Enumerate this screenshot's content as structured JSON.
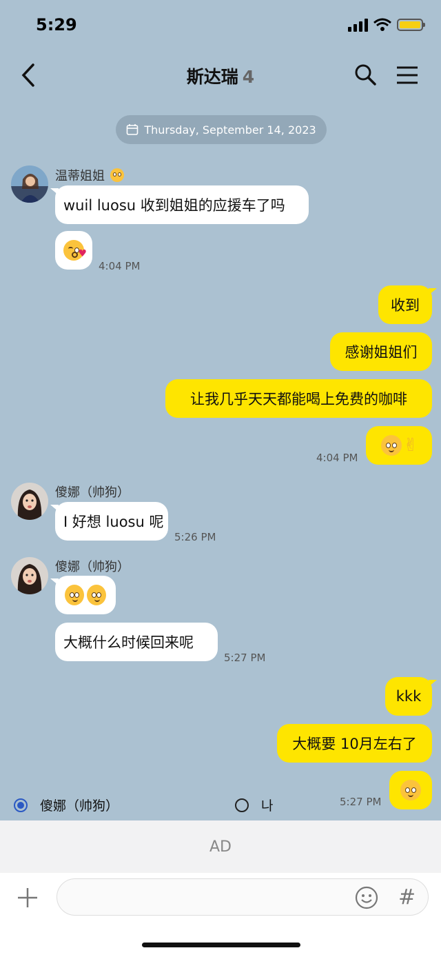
{
  "status_bar": {
    "time": "5:29"
  },
  "header": {
    "title": "斯达瑞",
    "member_count": "4"
  },
  "date_chip": "Thursday, September 14, 2023",
  "messages": {
    "m1_sender": "温蒂姐姐",
    "m1_text": "wuil luosu 收到姐姐的应援车了吗",
    "m1_time": "4:04 PM",
    "r1": "收到",
    "r2": "感谢姐姐们",
    "r3": "让我几乎天天都能喝上免费的咖啡",
    "r4_time": "4:04 PM",
    "m2_sender": "傻娜（帅狗）",
    "m2_text": "I 好想 luosu 呢",
    "m2_time": "5:26 PM",
    "m3_sender": "傻娜（帅狗）",
    "m3_text": "大概什么时候回来呢",
    "m3_time": "5:27 PM",
    "r5": "kkk",
    "r6": "大概要 10月左右了",
    "r7_time": "5:27 PM"
  },
  "poll": {
    "option1": "傻娜（帅狗）",
    "option2": "나",
    "option1_selected": true
  },
  "ad_label": "AD",
  "input": {
    "hash_label": "#"
  },
  "colors": {
    "background": "#abc1d1",
    "my_bubble": "#fee500",
    "their_bubble": "#ffffff"
  }
}
